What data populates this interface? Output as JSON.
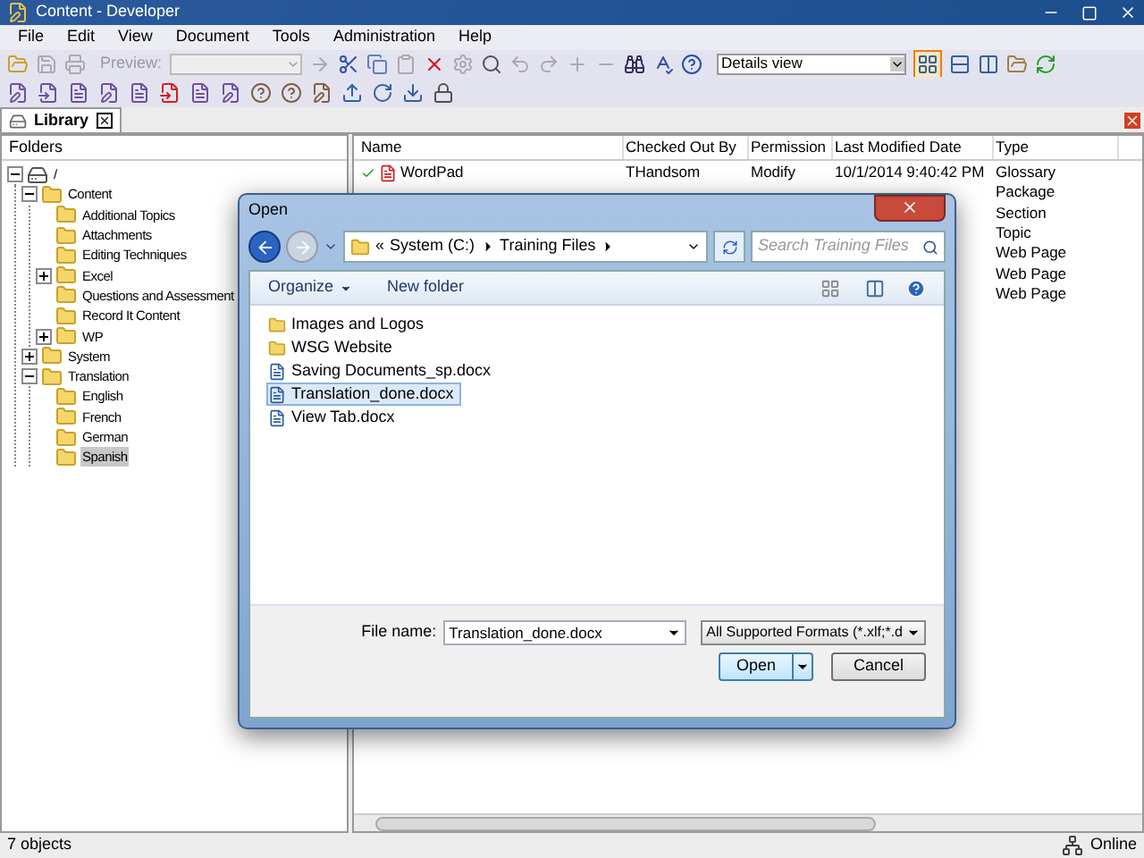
{
  "window": {
    "title": "Content - Developer"
  },
  "menu": [
    "File",
    "Edit",
    "View",
    "Document",
    "Tools",
    "Administration",
    "Help"
  ],
  "toolbar": {
    "preview_label": "Preview:",
    "view_select": "Details view"
  },
  "tabs": [
    {
      "label": "Library",
      "selected": true
    }
  ],
  "folders": {
    "heading": "Folders",
    "tree": [
      {
        "label": "/",
        "kind": "drive",
        "expanded": true,
        "selected": false,
        "children": [
          {
            "label": "Content",
            "kind": "folder",
            "expanded": true,
            "selected": false,
            "children": [
              {
                "label": "Additional Topics",
                "kind": "folder",
                "selected": false
              },
              {
                "label": "Attachments",
                "kind": "folder",
                "selected": false
              },
              {
                "label": "Editing Techniques",
                "kind": "folder",
                "selected": false
              },
              {
                "label": "Excel",
                "kind": "folder",
                "expanded": false,
                "selected": false
              },
              {
                "label": "Questions and Assessment",
                "kind": "folder",
                "selected": false
              },
              {
                "label": "Record It Content",
                "kind": "folder",
                "selected": false
              },
              {
                "label": "WP",
                "kind": "folder",
                "expanded": false,
                "selected": false
              }
            ]
          },
          {
            "label": "System",
            "kind": "folder",
            "expanded": false,
            "selected": false
          },
          {
            "label": "Translation",
            "kind": "folder",
            "expanded": true,
            "selected": false,
            "children": [
              {
                "label": "English",
                "kind": "folder",
                "selected": false
              },
              {
                "label": "French",
                "kind": "folder",
                "selected": false
              },
              {
                "label": "German",
                "kind": "folder",
                "selected": false
              },
              {
                "label": "Spanish",
                "kind": "folder",
                "selected": true
              }
            ]
          }
        ]
      }
    ]
  },
  "table": {
    "columns": [
      "Name",
      "Checked Out By",
      "Permission",
      "Last Modified Date",
      "Type"
    ],
    "rows": [
      {
        "name": "WordPad",
        "checked_out_by": "THandsom",
        "permission": "Modify",
        "date": "10/1/2014 9:40:42 PM",
        "type": "Glossary"
      },
      {
        "type": "Package"
      },
      {
        "type": "Section"
      },
      {
        "type": "Topic"
      },
      {
        "type": "Web Page"
      },
      {
        "type": "Web Page"
      },
      {
        "type": "Web Page"
      }
    ]
  },
  "dialog": {
    "title": "Open",
    "overflow_marker": "«",
    "path": [
      "System (C:)",
      "Training Files"
    ],
    "search_placeholder": "Search Training Files",
    "organize": "Organize",
    "new_folder": "New folder",
    "files": [
      {
        "name": "Images and Logos",
        "kind": "folder",
        "selected": false
      },
      {
        "name": "WSG Website",
        "kind": "folder",
        "selected": false
      },
      {
        "name": "Saving Documents_sp.docx",
        "kind": "document",
        "selected": false
      },
      {
        "name": "Translation_done.docx",
        "kind": "document",
        "selected": true
      },
      {
        "name": "View Tab.docx",
        "kind": "document",
        "selected": false
      }
    ],
    "file_name_label": "File name:",
    "file_name": "Translation_done.docx",
    "file_type": "All Supported Formats (*.xlf;*.d",
    "open": "Open",
    "cancel": "Cancel"
  },
  "status_bar": {
    "count": "7 objects",
    "connection": "Online"
  }
}
